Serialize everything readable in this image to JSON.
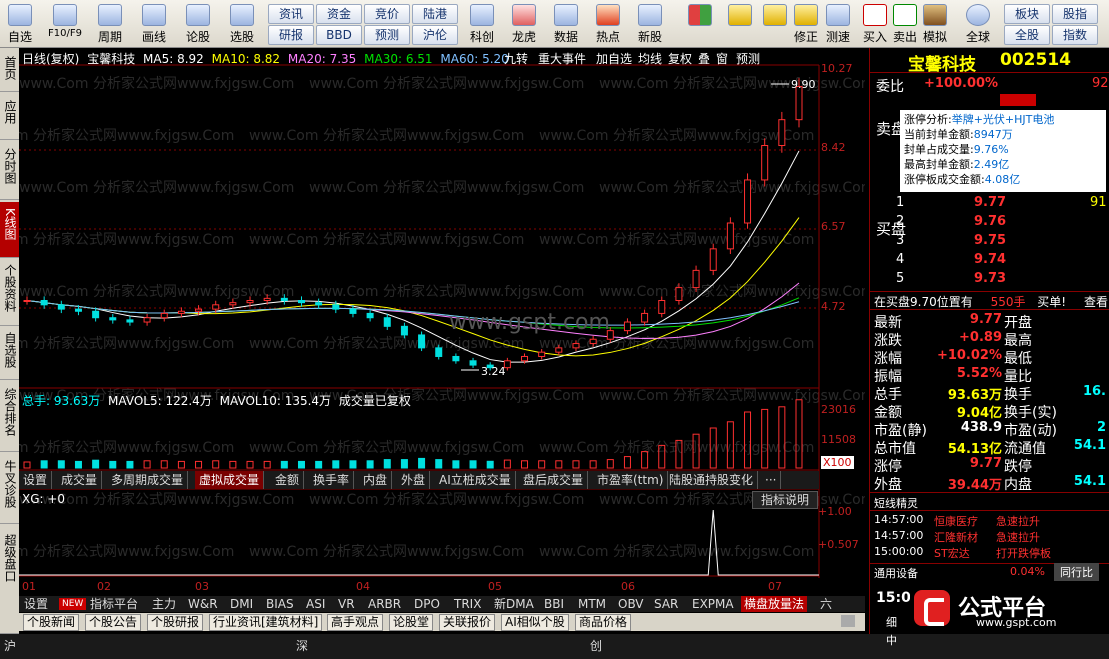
{
  "toolbar": {
    "buttons": [
      "自选",
      "F10/F9",
      "周期",
      "画线",
      "论股",
      "选股",
      "科创",
      "龙虎",
      "数据",
      "热点",
      "新股",
      "修正",
      "测速",
      "买入",
      "卖出",
      "模拟",
      "全球"
    ],
    "small_buttons": [
      "资讯",
      "资金",
      "竞价",
      "陆港",
      "研报",
      "BBD",
      "预测",
      "沪伦",
      "板块",
      "股指",
      "全股",
      "指数"
    ]
  },
  "left_tabs": [
    "首页",
    "应用",
    "分时图",
    "K线图",
    "个股资料",
    "自选股",
    "综合排名",
    "牛叉诊股",
    "超级盘口"
  ],
  "chart": {
    "header": {
      "period": "日线(复权)",
      "name": "宝馨科技",
      "ma5": "MA5: 8.92",
      "ma10": "MA10: 8.82",
      "ma20": "MA20: 7.35",
      "ma30": "MA30: 6.51",
      "ma60": "MA60: 5.20"
    },
    "func_tabs": [
      "九转",
      "重大事件",
      "加自选",
      "均线",
      "复权",
      "叠",
      "窗",
      "预测"
    ],
    "price_axis": [
      "10.27",
      "8.42",
      "6.57",
      "4.72"
    ],
    "high_label": "9.90",
    "low_label": "3.24",
    "watermark": "www.gspt.com",
    "volume_header": {
      "total": "总手: 93.63万",
      "mavol5": "MAVOL5: 122.4万",
      "mavol10": "MAVOL10: 135.4万",
      "note": "成交量已复权"
    },
    "volume_axis": [
      "23016",
      "11508",
      "X100"
    ],
    "sub_tabs": [
      "设置",
      "成交量",
      "多周期成交量",
      "虚拟成交量",
      "金额",
      "换手率",
      "内盘",
      "外盘",
      "AI立桩成交量",
      "盘后成交量",
      "市盈率(ttm)",
      "陆股通持股变化",
      "···"
    ],
    "indicator_help": "指标说明",
    "xg_label": "XG: +0",
    "xg_axis": [
      "+1.00",
      "+0.507"
    ],
    "months": [
      "01",
      "02",
      "03",
      "04",
      "05",
      "06",
      "07"
    ]
  },
  "chart_data": {
    "type": "candlestick",
    "title": "宝馨科技 日线(复权)",
    "y_range": [
      3.0,
      10.27
    ],
    "high": 9.9,
    "low": 3.24,
    "ma_latest": {
      "MA5": 8.92,
      "MA10": 8.82,
      "MA20": 7.35,
      "MA30": 6.51,
      "MA60": 5.2
    },
    "months": [
      "01",
      "02",
      "03",
      "04",
      "05",
      "06",
      "07"
    ],
    "close_series": [
      4.8,
      4.7,
      4.6,
      4.55,
      4.4,
      4.35,
      4.3,
      4.4,
      4.5,
      4.55,
      4.6,
      4.7,
      4.75,
      4.8,
      4.85,
      4.8,
      4.75,
      4.7,
      4.6,
      4.5,
      4.4,
      4.2,
      4.0,
      3.7,
      3.5,
      3.4,
      3.3,
      3.24,
      3.4,
      3.5,
      3.6,
      3.7,
      3.8,
      3.9,
      4.1,
      4.3,
      4.5,
      4.8,
      5.1,
      5.5,
      6.0,
      6.6,
      7.6,
      8.4,
      9.0,
      9.77
    ],
    "xg_signal": {
      "index": 40,
      "value": 1.0
    }
  },
  "bottom_tabs": [
    "设置",
    "指标平台",
    "主力",
    "W&R",
    "DMI",
    "BIAS",
    "ASI",
    "VR",
    "ARBR",
    "DPO",
    "TRIX",
    "新DMA",
    "BBI",
    "MTM",
    "OBV",
    "SAR",
    "EXPMA",
    "横盘放量法",
    "六"
  ],
  "new_badge": "NEW",
  "news_tabs": [
    "个股新闻",
    "个股公告",
    "个股研报",
    "行业资讯[建筑材料]",
    "高手观点",
    "论股堂",
    "关联报价",
    "AI相似个股",
    "商品价格"
  ],
  "status": {
    "sh": "沪",
    "sz": "深",
    "cy": "创"
  },
  "right": {
    "title": "宝馨科技",
    "code": "002514",
    "weibi_label": "委比",
    "weibi": "+100.00%",
    "weibi_right": "92",
    "sell_label": "卖盘",
    "buy_label": "买盘",
    "analysis_label": "涨停分析:",
    "analysis_tags": "举牌+光伏+HJT电池",
    "info": [
      {
        "k": "当前封单金额:",
        "v": "8947万"
      },
      {
        "k": "封单占成交量:",
        "v": "9.76%"
      },
      {
        "k": "最高封单金额:",
        "v": "2.49亿"
      },
      {
        "k": "涨停板成交金额:",
        "v": "4.08亿"
      }
    ],
    "bids": [
      {
        "n": "1",
        "p": "9.77",
        "v": "91"
      },
      {
        "n": "2",
        "p": "9.76",
        "v": ""
      },
      {
        "n": "3",
        "p": "9.75",
        "v": ""
      },
      {
        "n": "4",
        "p": "9.74",
        "v": ""
      },
      {
        "n": "5",
        "p": "9.73",
        "v": ""
      }
    ],
    "queue_text": "在买盘9.70位置有",
    "queue_vol": "550手",
    "queue_buy": "买单!",
    "queue_view": "查看",
    "quote_left": [
      {
        "k": "最新",
        "v": "9.77"
      },
      {
        "k": "涨跌",
        "v": "+0.89"
      },
      {
        "k": "涨幅",
        "v": "+10.02%"
      },
      {
        "k": "振幅",
        "v": "5.52%"
      },
      {
        "k": "总手",
        "v": "93.63万"
      },
      {
        "k": "金额",
        "v": "9.04亿"
      },
      {
        "k": "市盈(静)",
        "v": "438.9"
      },
      {
        "k": "总市值",
        "v": "54.13亿"
      },
      {
        "k": "涨停",
        "v": "9.77"
      },
      {
        "k": "外盘",
        "v": "39.44万"
      }
    ],
    "quote_right": [
      {
        "k": "开盘",
        "v": ""
      },
      {
        "k": "最高",
        "v": ""
      },
      {
        "k": "最低",
        "v": ""
      },
      {
        "k": "量比",
        "v": ""
      },
      {
        "k": "换手",
        "v": "16."
      },
      {
        "k": "换手(实)",
        "v": ""
      },
      {
        "k": "市盈(动)",
        "v": "2"
      },
      {
        "k": "流通值",
        "v": "54.1"
      },
      {
        "k": "跌停",
        "v": ""
      },
      {
        "k": "内盘",
        "v": "54.1"
      }
    ],
    "elves_title": "短线精灵",
    "elves": [
      {
        "t": "14:57:00",
        "n": "恒康医疗",
        "e": "急速拉升"
      },
      {
        "t": "14:57:00",
        "n": "汇隆新材",
        "e": "急速拉升"
      },
      {
        "t": "15:00:00",
        "n": "ST宏达",
        "e": "打开跌停板"
      }
    ],
    "general_device": "通用设备",
    "general_pct": "0.04%",
    "peer_rank": "同行比",
    "time_bottom": "15:00",
    "logo_text": "公式平台",
    "logo_url": "www.gspt.com",
    "bottom_tab_left": "细",
    "bottom_tab_right": "中"
  }
}
